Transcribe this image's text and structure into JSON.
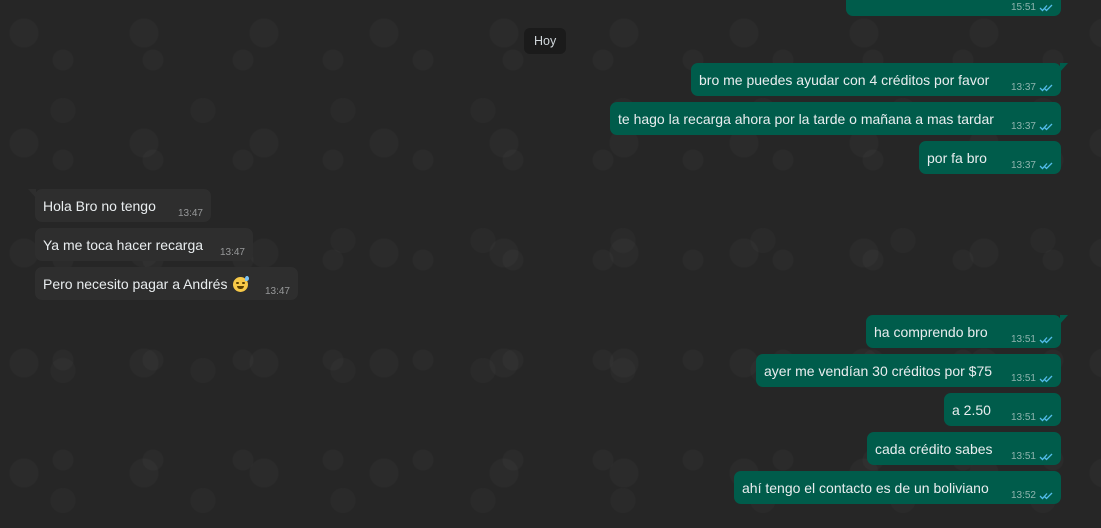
{
  "date_chip": "Hoy",
  "messages": [
    {
      "dir": "out",
      "text": "",
      "time": "15:51",
      "read": true
    },
    {
      "dir": "out",
      "text": "bro me puedes ayudar con 4 créditos por favor",
      "time": "13:37",
      "read": true
    },
    {
      "dir": "out",
      "text": "te hago la recarga ahora por la tarde o mañana a mas tardar",
      "time": "13:37",
      "read": true
    },
    {
      "dir": "out",
      "text": "por fa bro",
      "time": "13:37",
      "read": true
    },
    {
      "dir": "in",
      "text": "Hola Bro no tengo",
      "time": "13:47"
    },
    {
      "dir": "in",
      "text": "Ya me toca hacer recarga",
      "time": "13:47"
    },
    {
      "dir": "in",
      "text": "Pero necesito pagar a Andrés",
      "emoji": "grinning-sweat-emoji",
      "time": "13:47"
    },
    {
      "dir": "out",
      "text": "ha comprendo bro",
      "time": "13:51",
      "read": true
    },
    {
      "dir": "out",
      "text": "ayer me vendían 30 créditos por $75",
      "time": "13:51",
      "read": true
    },
    {
      "dir": "out",
      "text": "a 2.50",
      "time": "13:51",
      "read": true
    },
    {
      "dir": "out",
      "text": "cada crédito sabes",
      "time": "13:51",
      "read": true
    },
    {
      "dir": "out",
      "text": "ahí tengo el contacto es de un boliviano",
      "time": "13:52",
      "read": true
    }
  ],
  "colors": {
    "outgoing_bubble": "#005c4b",
    "incoming_bubble": "#2e2e2e",
    "read_ticks": "#53bdeb",
    "wallpaper": "#262626"
  }
}
